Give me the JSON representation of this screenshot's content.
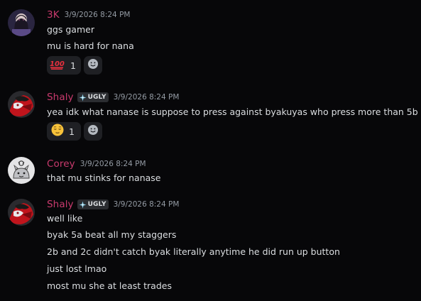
{
  "messages": [
    {
      "username": "3K",
      "timestamp": "3/9/2026 8:24 PM",
      "lines": [
        "ggs gamer",
        "mu is hard for nana"
      ],
      "reaction": {
        "emoji": "100-emoji-icon",
        "count": "1"
      }
    },
    {
      "username": "Shaly",
      "tag": "UGLY",
      "timestamp": "3/9/2026 8:24 PM",
      "lines": [
        "yea idk what nanase is suppose to press against byakuyas who press more than 5b"
      ],
      "reaction": {
        "emoji": "relieved-face-emoji-icon",
        "count": "1"
      }
    },
    {
      "username": "Corey",
      "timestamp": "3/9/2026 8:24 PM",
      "lines": [
        "that mu stinks for nanase"
      ]
    },
    {
      "username": "Shaly",
      "tag": "UGLY",
      "timestamp": "3/9/2026 8:24 PM",
      "lines": [
        "well like",
        "byak 5a beat all my staggers",
        "2b and 2c didn't catch byak literally anytime he did run up button",
        "just lost lmao",
        "most mu she at least trades"
      ]
    }
  ],
  "colors": {
    "background": "#070709",
    "username": "#c93a6d",
    "text": "#dbdee1",
    "timestamp": "#949ba4",
    "reaction_bg": "#1f2024"
  }
}
